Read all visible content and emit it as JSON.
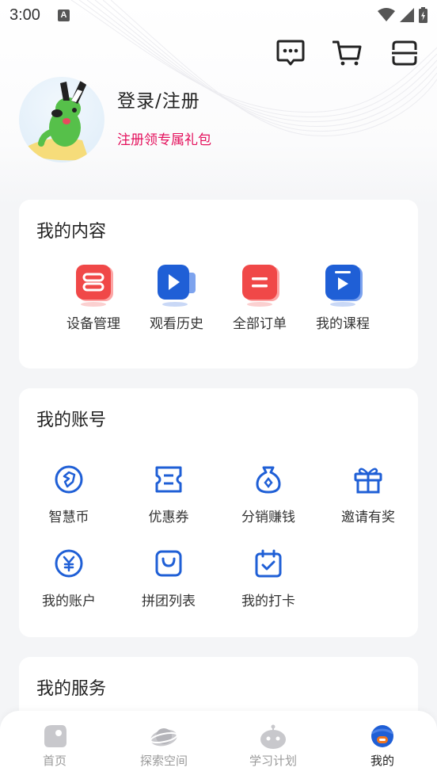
{
  "status_bar": {
    "time": "3:00",
    "notification_letter": "A"
  },
  "profile": {
    "login_label": "登录/注册",
    "gift_label": "注册领专属礼包"
  },
  "content_card": {
    "title": "我的内容",
    "items": [
      {
        "label": "设备管理",
        "icon": "device-icon"
      },
      {
        "label": "观看历史",
        "icon": "video-icon"
      },
      {
        "label": "全部订单",
        "icon": "order-icon"
      },
      {
        "label": "我的课程",
        "icon": "course-icon"
      }
    ]
  },
  "account_card": {
    "title": "我的账号",
    "items": [
      {
        "label": "智慧币",
        "icon": "coin-icon"
      },
      {
        "label": "优惠券",
        "icon": "coupon-icon"
      },
      {
        "label": "分销赚钱",
        "icon": "money-bag-icon"
      },
      {
        "label": "邀请有奖",
        "icon": "gift-icon"
      },
      {
        "label": "我的账户",
        "icon": "yen-icon"
      },
      {
        "label": "拼团列表",
        "icon": "shopping-bag-icon"
      },
      {
        "label": "我的打卡",
        "icon": "calendar-check-icon"
      }
    ]
  },
  "service_card": {
    "title": "我的服务"
  },
  "tabbar": {
    "tabs": [
      {
        "label": "首页",
        "icon": "home-icon"
      },
      {
        "label": "探索空间",
        "icon": "planet-icon"
      },
      {
        "label": "学习计划",
        "icon": "robot-icon"
      },
      {
        "label": "我的",
        "icon": "profile-icon"
      }
    ],
    "active_index": 3
  },
  "colors": {
    "accent_blue": "#1f5fd6",
    "accent_red": "#f04848",
    "promo_pink": "#e4105c"
  }
}
